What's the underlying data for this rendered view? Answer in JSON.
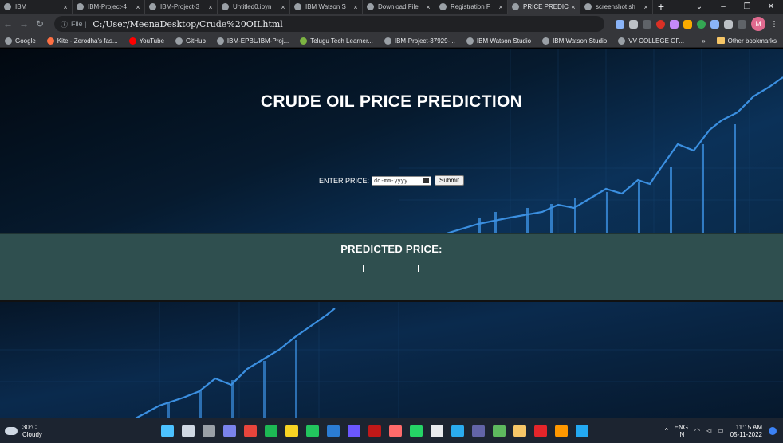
{
  "tabs": [
    {
      "title": "IBM",
      "active": false
    },
    {
      "title": "IBM-Project-4",
      "active": false
    },
    {
      "title": "IBM-Project-3",
      "active": false
    },
    {
      "title": "Untitled0.ipyn",
      "active": false
    },
    {
      "title": "IBM Watson S",
      "active": false
    },
    {
      "title": "Download File",
      "active": false
    },
    {
      "title": "Registration F",
      "active": false
    },
    {
      "title": "PRICE PREDIC",
      "active": true
    },
    {
      "title": "screenshot sh",
      "active": false
    }
  ],
  "tab_close": "×",
  "new_tab": "+",
  "window_controls": {
    "chevron": "⌄",
    "minimize": "–",
    "restore": "❐",
    "close": "✕"
  },
  "nav": {
    "back": "←",
    "forward": "→",
    "reload": "↻"
  },
  "address": {
    "info_icon": "ⓘ",
    "scheme": "File |",
    "url": "C:/User/MeenaDesktop/Crude%20OILhtml"
  },
  "profile_initial": "M",
  "menu_glyph": "⋮",
  "bookmarks": [
    {
      "label": "Google",
      "icon": "globe-icon"
    },
    {
      "label": "Kite - Zerodha's fas...",
      "icon": "kite-icon"
    },
    {
      "label": "YouTube",
      "icon": "youtube-icon"
    },
    {
      "label": "GitHub",
      "icon": "github-icon"
    },
    {
      "label": "IBM-EPBL/IBM-Proj...",
      "icon": "github-icon"
    },
    {
      "label": "Telugu Tech Learner...",
      "icon": "android-icon"
    },
    {
      "label": "IBM-Project-37929-...",
      "icon": "github-icon"
    },
    {
      "label": "IBM Watson Studio",
      "icon": "ibm-icon"
    },
    {
      "label": "IBM Watson Studio",
      "icon": "ibm-icon"
    },
    {
      "label": "VV COLLEGE OF...",
      "icon": "globe-icon"
    }
  ],
  "bookmarks_more": "»",
  "other_bookmarks": "Other bookmarks",
  "page": {
    "title": "CRUDE OIL PRICE PREDICTION",
    "enter_label": "ENTER PRICE:",
    "date_placeholder": "dd-mm-yyyy",
    "submit_label": "Submit",
    "predicted_label": "PREDICTED PRICE:"
  },
  "weather": {
    "temp": "30°C",
    "condition": "Cloudy"
  },
  "taskbar_apps": [
    {
      "name": "windows-start-icon",
      "color": "#4cc2ff"
    },
    {
      "name": "search-icon",
      "color": "#cfd8e3"
    },
    {
      "name": "task-view-icon",
      "color": "#9aa0a6"
    },
    {
      "name": "chat-icon",
      "color": "#7b83eb"
    },
    {
      "name": "chrome-icon",
      "color": "#e8453c"
    },
    {
      "name": "spotify-icon",
      "color": "#1db954"
    },
    {
      "name": "photo-icon",
      "color": "#f9d423"
    },
    {
      "name": "circle-app-icon",
      "color": "#22c55e"
    },
    {
      "name": "word-icon",
      "color": "#2b7cd3"
    },
    {
      "name": "intellij-icon",
      "color": "#6b57ff"
    },
    {
      "name": "mcafee-icon",
      "color": "#c01818"
    },
    {
      "name": "app-icon",
      "color": "#ff6b6b"
    },
    {
      "name": "whatsapp-icon",
      "color": "#25d366"
    },
    {
      "name": "tabs-icon",
      "color": "#e8eaed"
    },
    {
      "name": "telegram-icon",
      "color": "#2aabee"
    },
    {
      "name": "teams-icon",
      "color": "#6264a7"
    },
    {
      "name": "notepad-icon",
      "color": "#5eb95e"
    },
    {
      "name": "file-explorer-icon",
      "color": "#f6c667"
    },
    {
      "name": "acrobat-icon",
      "color": "#e5252a"
    },
    {
      "name": "sublime-icon",
      "color": "#ff9800"
    },
    {
      "name": "vscode-icon",
      "color": "#23a9f2"
    }
  ],
  "tray": {
    "up_arrow": "^",
    "lang_line1": "ENG",
    "lang_line2": "IN",
    "time": "11:15 AM",
    "date": "05-11-2022"
  },
  "colors": {
    "predict_band": "#2f4f4f",
    "hero_bg": "#020810",
    "accent_chart": "#3b8fe0"
  }
}
